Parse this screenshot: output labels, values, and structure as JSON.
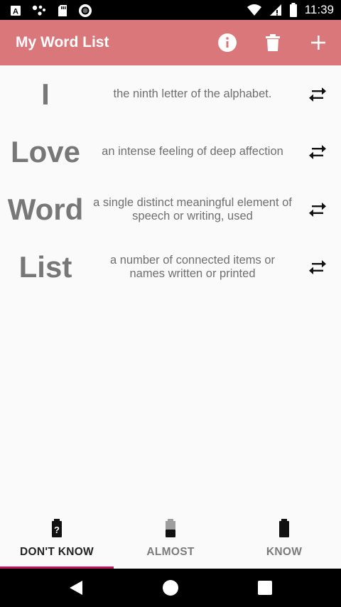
{
  "status_bar": {
    "time": "11:39",
    "left_icons": [
      "app-notification-icon",
      "assistant-icon",
      "sd-card-icon",
      "sync-icon"
    ],
    "right_icons": [
      "wifi-icon",
      "cell-signal-icon",
      "battery-icon"
    ]
  },
  "app_bar": {
    "title": "My Word List",
    "actions": [
      "info-icon",
      "delete-icon",
      "add-icon"
    ],
    "color": "#d9777a"
  },
  "words": [
    {
      "word": "I",
      "definition": "the ninth letter of the alphabet."
    },
    {
      "word": "Love",
      "definition": "an intense feeling of deep affection"
    },
    {
      "word": "Word",
      "definition": "a single distinct meaningful element of speech or writing, used"
    },
    {
      "word": "List",
      "definition": "a number of connected items or names written or printed"
    }
  ],
  "bottom_tabs": [
    {
      "label": "DON'T KNOW",
      "icon": "battery-unknown-icon",
      "selected": true
    },
    {
      "label": "ALMOST",
      "icon": "battery-half-icon",
      "selected": false
    },
    {
      "label": "KNOW",
      "icon": "battery-full-icon",
      "selected": false
    }
  ],
  "nav_bar": {
    "buttons": [
      "back-icon",
      "home-icon",
      "recents-icon"
    ]
  },
  "colors": {
    "accent": "#c2185b",
    "word_text": "#777777"
  }
}
